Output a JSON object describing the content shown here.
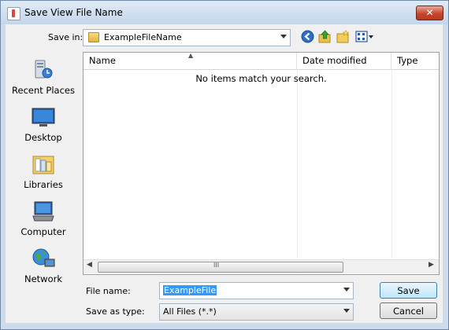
{
  "window": {
    "title": "Save View File Name",
    "close_glyph": "✕"
  },
  "toolbar": {
    "save_in_label": "Save in:",
    "save_in_value": "ExampleFileName",
    "icons": [
      "back-icon",
      "up-folder-icon",
      "new-folder-icon",
      "view-menu-icon"
    ]
  },
  "places": [
    {
      "label": "Recent Places",
      "icon": "recent-places-icon"
    },
    {
      "label": "Desktop",
      "icon": "desktop-icon"
    },
    {
      "label": "Libraries",
      "icon": "libraries-icon"
    },
    {
      "label": "Computer",
      "icon": "computer-icon"
    },
    {
      "label": "Network",
      "icon": "network-icon"
    }
  ],
  "list": {
    "columns": [
      "Name",
      "Date modified",
      "Type"
    ],
    "empty_message": "No items match your search.",
    "scroll_grip": "III"
  },
  "form": {
    "file_name_label": "File name:",
    "file_name_value": "ExampleFile",
    "save_as_type_label": "Save as type:",
    "save_as_type_value": "All Files (*.*)"
  },
  "buttons": {
    "save": "Save",
    "cancel": "Cancel"
  },
  "colors": {
    "selection": "#3399ff",
    "accent": "#cc4422"
  }
}
